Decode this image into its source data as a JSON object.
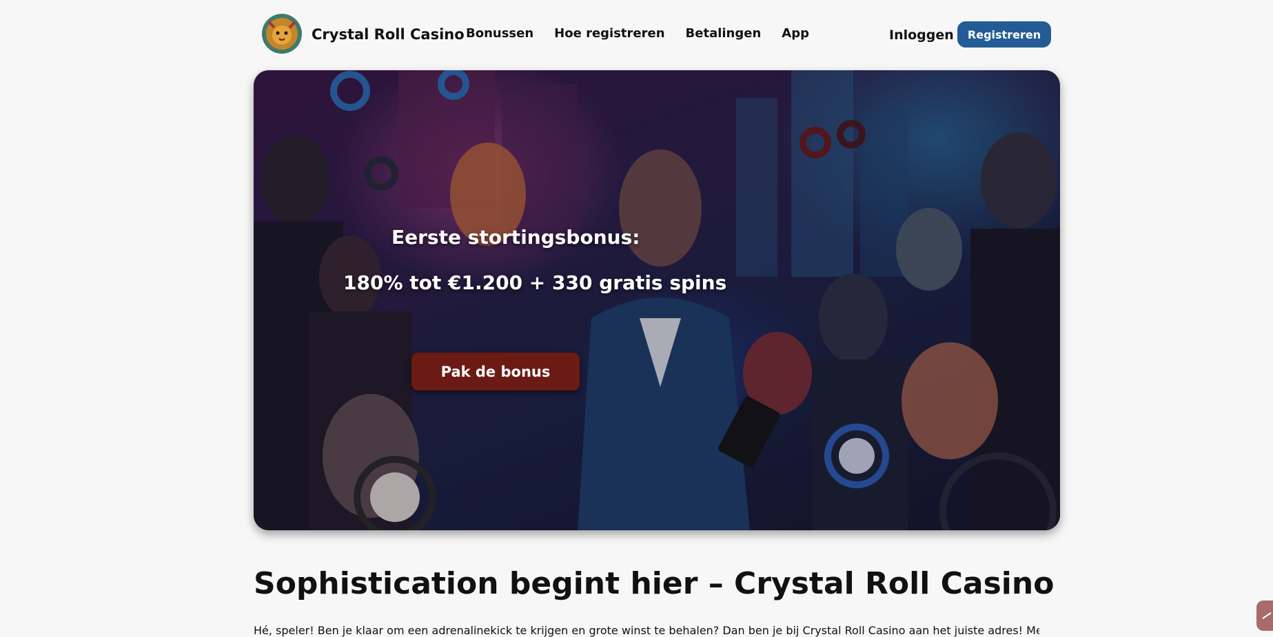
{
  "header": {
    "brand": "Crystal Roll Casino",
    "nav": [
      "Bonussen",
      "Hoe registreren",
      "Betalingen",
      "App"
    ],
    "login_label": "Inloggen",
    "register_label": "Registreren"
  },
  "hero": {
    "line1": "Eerste stortingsbonus:",
    "line2": "180% tot €1.200 + 330 gratis spins",
    "cta_label": "Pak de bonus"
  },
  "content": {
    "heading": "Sophistication begint hier – Crystal Roll Casino",
    "intro": "Hé, speler! Ben je klaar om een adrenalinekick te krijgen en grote winst te behalen? Dan ben je bij Crystal Roll Casino aan het juiste adres! Met"
  },
  "colors": {
    "accent": "#235c95",
    "cta": "#6b1b14",
    "background": "#f7f7f7"
  },
  "icons": {
    "logo": "lion-crest-logo",
    "scroll_top": "arrow-up-icon"
  }
}
